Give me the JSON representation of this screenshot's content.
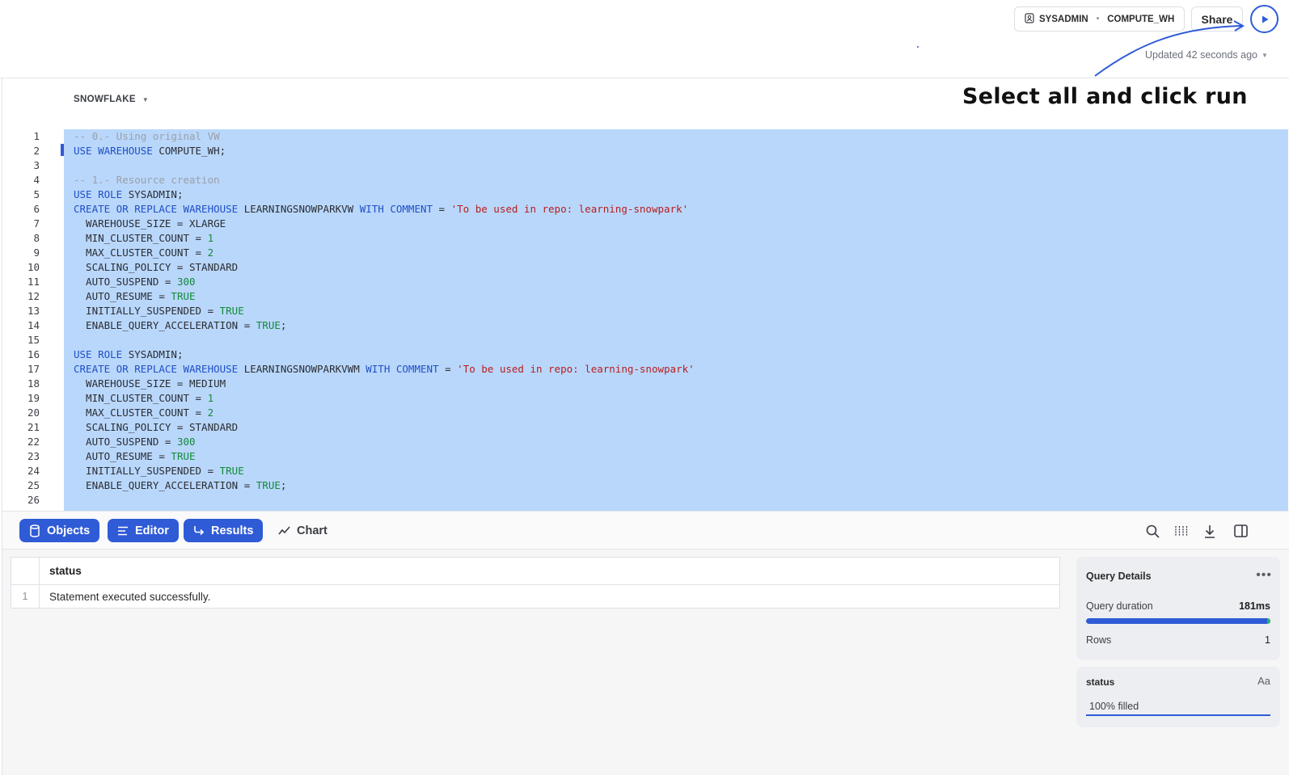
{
  "header": {
    "role": "SYSADMIN",
    "warehouse": "COMPUTE_WH",
    "share_label": "Share",
    "updated_text": "Updated 42 seconds ago"
  },
  "annotation": {
    "text": "Select all and click run"
  },
  "editor": {
    "database": "SNOWFLAKE",
    "line_numbers": [
      "1",
      "2",
      "3",
      "4",
      "5",
      "6",
      "7",
      "8",
      "9",
      "10",
      "11",
      "12",
      "13",
      "14",
      "15",
      "16",
      "17",
      "18",
      "19",
      "20",
      "21",
      "22",
      "23",
      "24",
      "25",
      "26"
    ],
    "lines": [
      [
        {
          "t": "-- 0.- Using original VW",
          "c": "cm"
        }
      ],
      [
        {
          "t": "USE WAREHOUSE",
          "c": "kw"
        },
        {
          "t": " COMPUTE_WH;",
          "c": "pl"
        }
      ],
      [],
      [
        {
          "t": "-- 1.- Resource creation",
          "c": "cm"
        }
      ],
      [
        {
          "t": "USE ROLE",
          "c": "kw"
        },
        {
          "t": " SYSADMIN;",
          "c": "pl"
        }
      ],
      [
        {
          "t": "CREATE OR REPLACE WAREHOUSE",
          "c": "kw"
        },
        {
          "t": " LEARNINGSNOWPARKVW ",
          "c": "pl"
        },
        {
          "t": "WITH COMMENT",
          "c": "kw"
        },
        {
          "t": " = ",
          "c": "pl"
        },
        {
          "t": "'To be used in repo: learning-snowpark'",
          "c": "str"
        }
      ],
      [
        {
          "t": "  WAREHOUSE_SIZE = XLARGE",
          "c": "pl"
        }
      ],
      [
        {
          "t": "  MIN_CLUSTER_COUNT = ",
          "c": "pl"
        },
        {
          "t": "1",
          "c": "num"
        }
      ],
      [
        {
          "t": "  MAX_CLUSTER_COUNT = ",
          "c": "pl"
        },
        {
          "t": "2",
          "c": "num"
        }
      ],
      [
        {
          "t": "  SCALING_POLICY = STANDARD",
          "c": "pl"
        }
      ],
      [
        {
          "t": "  AUTO_SUSPEND = ",
          "c": "pl"
        },
        {
          "t": "300",
          "c": "num"
        }
      ],
      [
        {
          "t": "  AUTO_RESUME = ",
          "c": "pl"
        },
        {
          "t": "TRUE",
          "c": "num"
        }
      ],
      [
        {
          "t": "  INITIALLY_SUSPENDED = ",
          "c": "pl"
        },
        {
          "t": "TRUE",
          "c": "num"
        }
      ],
      [
        {
          "t": "  ENABLE_QUERY_ACCELERATION = ",
          "c": "pl"
        },
        {
          "t": "TRUE",
          "c": "num"
        },
        {
          "t": ";",
          "c": "pl"
        }
      ],
      [],
      [
        {
          "t": "USE ROLE",
          "c": "kw"
        },
        {
          "t": " SYSADMIN;",
          "c": "pl"
        }
      ],
      [
        {
          "t": "CREATE OR REPLACE WAREHOUSE",
          "c": "kw"
        },
        {
          "t": " LEARNINGSNOWPARKVWM ",
          "c": "pl"
        },
        {
          "t": "WITH COMMENT",
          "c": "kw"
        },
        {
          "t": " = ",
          "c": "pl"
        },
        {
          "t": "'To be used in repo: learning-snowpark'",
          "c": "str"
        }
      ],
      [
        {
          "t": "  WAREHOUSE_SIZE = MEDIUM",
          "c": "pl"
        }
      ],
      [
        {
          "t": "  MIN_CLUSTER_COUNT = ",
          "c": "pl"
        },
        {
          "t": "1",
          "c": "num"
        }
      ],
      [
        {
          "t": "  MAX_CLUSTER_COUNT = ",
          "c": "pl"
        },
        {
          "t": "2",
          "c": "num"
        }
      ],
      [
        {
          "t": "  SCALING_POLICY = STANDARD",
          "c": "pl"
        }
      ],
      [
        {
          "t": "  AUTO_SUSPEND = ",
          "c": "pl"
        },
        {
          "t": "300",
          "c": "num"
        }
      ],
      [
        {
          "t": "  AUTO_RESUME = ",
          "c": "pl"
        },
        {
          "t": "TRUE",
          "c": "num"
        }
      ],
      [
        {
          "t": "  INITIALLY_SUSPENDED = ",
          "c": "pl"
        },
        {
          "t": "TRUE",
          "c": "num"
        }
      ],
      [
        {
          "t": "  ENABLE_QUERY_ACCELERATION = ",
          "c": "pl"
        },
        {
          "t": "TRUE",
          "c": "num"
        },
        {
          "t": ";",
          "c": "pl"
        }
      ],
      []
    ]
  },
  "tabs": {
    "objects": "Objects",
    "editor": "Editor",
    "results": "Results",
    "chart": "Chart"
  },
  "results": {
    "column": "status",
    "row_index": "1",
    "row_value": "Statement executed successfully."
  },
  "query_details": {
    "title": "Query Details",
    "duration_label": "Query duration",
    "duration_value": "181ms",
    "duration_fraction": 1.0,
    "rows_label": "Rows",
    "rows_value": "1"
  },
  "status_card": {
    "title": "status",
    "type_label": "Aa",
    "fill_text": "100% filled"
  },
  "colors": {
    "accent": "#2f5bd6",
    "selection": "#b9d7fb",
    "keyword": "#1f4fc7",
    "string": "#b81d1d",
    "number": "#138a3a",
    "comment": "#9aa0a8"
  }
}
